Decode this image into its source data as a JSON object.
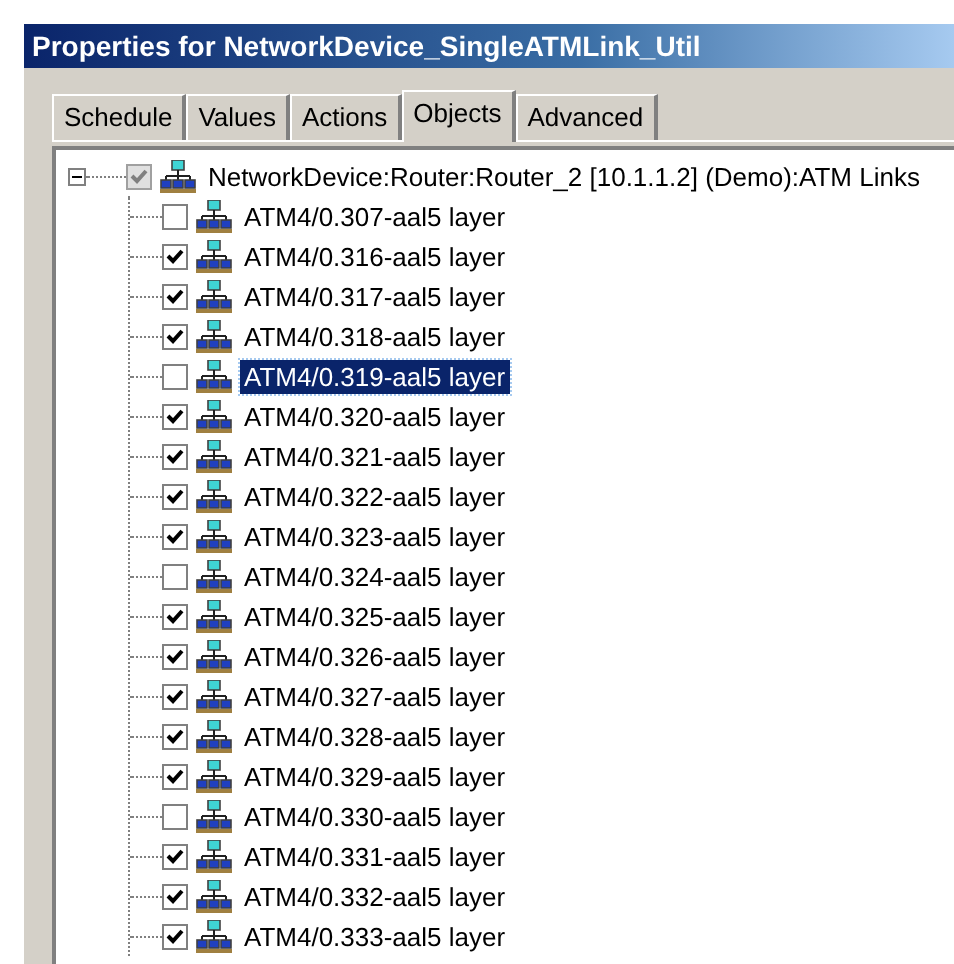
{
  "window": {
    "title": "Properties for NetworkDevice_SingleATMLink_Util"
  },
  "tabs": [
    {
      "label": "Schedule",
      "selected": false
    },
    {
      "label": "Values",
      "selected": false
    },
    {
      "label": "Actions",
      "selected": false
    },
    {
      "label": "Objects",
      "selected": true
    },
    {
      "label": "Advanced",
      "selected": false
    }
  ],
  "tree": {
    "root": {
      "label": "NetworkDevice:Router:Router_2 [10.1.1.2] (Demo):ATM Links",
      "expanded": true,
      "checked": true,
      "greyed": true,
      "children": [
        {
          "label": "ATM4/0.307-aal5 layer",
          "checked": false,
          "selected": false
        },
        {
          "label": "ATM4/0.316-aal5 layer",
          "checked": true,
          "selected": false
        },
        {
          "label": "ATM4/0.317-aal5 layer",
          "checked": true,
          "selected": false
        },
        {
          "label": "ATM4/0.318-aal5 layer",
          "checked": true,
          "selected": false
        },
        {
          "label": "ATM4/0.319-aal5 layer",
          "checked": false,
          "selected": true
        },
        {
          "label": "ATM4/0.320-aal5 layer",
          "checked": true,
          "selected": false
        },
        {
          "label": "ATM4/0.321-aal5 layer",
          "checked": true,
          "selected": false
        },
        {
          "label": "ATM4/0.322-aal5 layer",
          "checked": true,
          "selected": false
        },
        {
          "label": "ATM4/0.323-aal5 layer",
          "checked": true,
          "selected": false
        },
        {
          "label": "ATM4/0.324-aal5 layer",
          "checked": false,
          "selected": false
        },
        {
          "label": "ATM4/0.325-aal5 layer",
          "checked": true,
          "selected": false
        },
        {
          "label": "ATM4/0.326-aal5 layer",
          "checked": true,
          "selected": false
        },
        {
          "label": "ATM4/0.327-aal5 layer",
          "checked": true,
          "selected": false
        },
        {
          "label": "ATM4/0.328-aal5 layer",
          "checked": true,
          "selected": false
        },
        {
          "label": "ATM4/0.329-aal5 layer",
          "checked": true,
          "selected": false
        },
        {
          "label": "ATM4/0.330-aal5 layer",
          "checked": false,
          "selected": false
        },
        {
          "label": "ATM4/0.331-aal5 layer",
          "checked": true,
          "selected": false
        },
        {
          "label": "ATM4/0.332-aal5 layer",
          "checked": true,
          "selected": false
        },
        {
          "label": "ATM4/0.333-aal5 layer",
          "checked": true,
          "selected": false
        }
      ]
    }
  }
}
